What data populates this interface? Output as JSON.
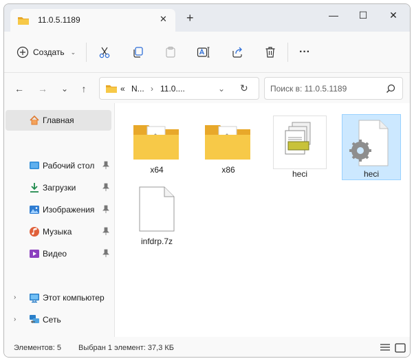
{
  "window": {
    "tab_title": "11.0.5.1189",
    "tab_close": "✕",
    "new_tab": "+",
    "controls": {
      "minimize": "—",
      "maximize": "☐",
      "close": "✕"
    }
  },
  "toolbar": {
    "create_label": "Создать",
    "create_caret": "⌄",
    "icons": [
      "cut-icon",
      "copy-icon",
      "paste-icon",
      "rename-icon",
      "share-icon",
      "delete-icon",
      "more-icon"
    ],
    "more_label": "···"
  },
  "address": {
    "overflow": "«",
    "crumb1": "N...",
    "sep1": "›",
    "crumb2": "11.0....",
    "sep2": "›",
    "dropdown": "⌄",
    "refresh": "↻"
  },
  "nav": {
    "back": "←",
    "forward": "→",
    "recent": "⌄",
    "up": "↑"
  },
  "search": {
    "placeholder": "Поиск в: 11.0.5.1189"
  },
  "sidebar": {
    "home": "Главная",
    "items": [
      {
        "label": "Рабочий стол",
        "icon": "desktop-icon",
        "color": "#2b8ad6"
      },
      {
        "label": "Загрузки",
        "icon": "download-icon",
        "color": "#1f8a4c"
      },
      {
        "label": "Изображения",
        "icon": "pictures-icon",
        "color": "#2f7cd1"
      },
      {
        "label": "Музыка",
        "icon": "music-icon",
        "color": "#e0603a"
      },
      {
        "label": "Видео",
        "icon": "video-icon",
        "color": "#8b3fbf"
      }
    ],
    "this_pc": "Этот компьютер",
    "network": "Сеть",
    "chevron": "›"
  },
  "files": [
    {
      "name": "x64",
      "type": "folder"
    },
    {
      "name": "x86",
      "type": "folder"
    },
    {
      "name": "heci",
      "type": "setup-info"
    },
    {
      "name": "heci",
      "type": "system-file",
      "selected": true
    },
    {
      "name": "infdrp.7z",
      "type": "blank-file"
    }
  ],
  "status": {
    "count": "Элементов: 5",
    "selection": "Выбран 1 элемент: 37,3 КБ"
  },
  "colors": {
    "accent_selection": "#cce8ff",
    "folder": "#f5c342",
    "titlebar": "#e8ebf0"
  }
}
